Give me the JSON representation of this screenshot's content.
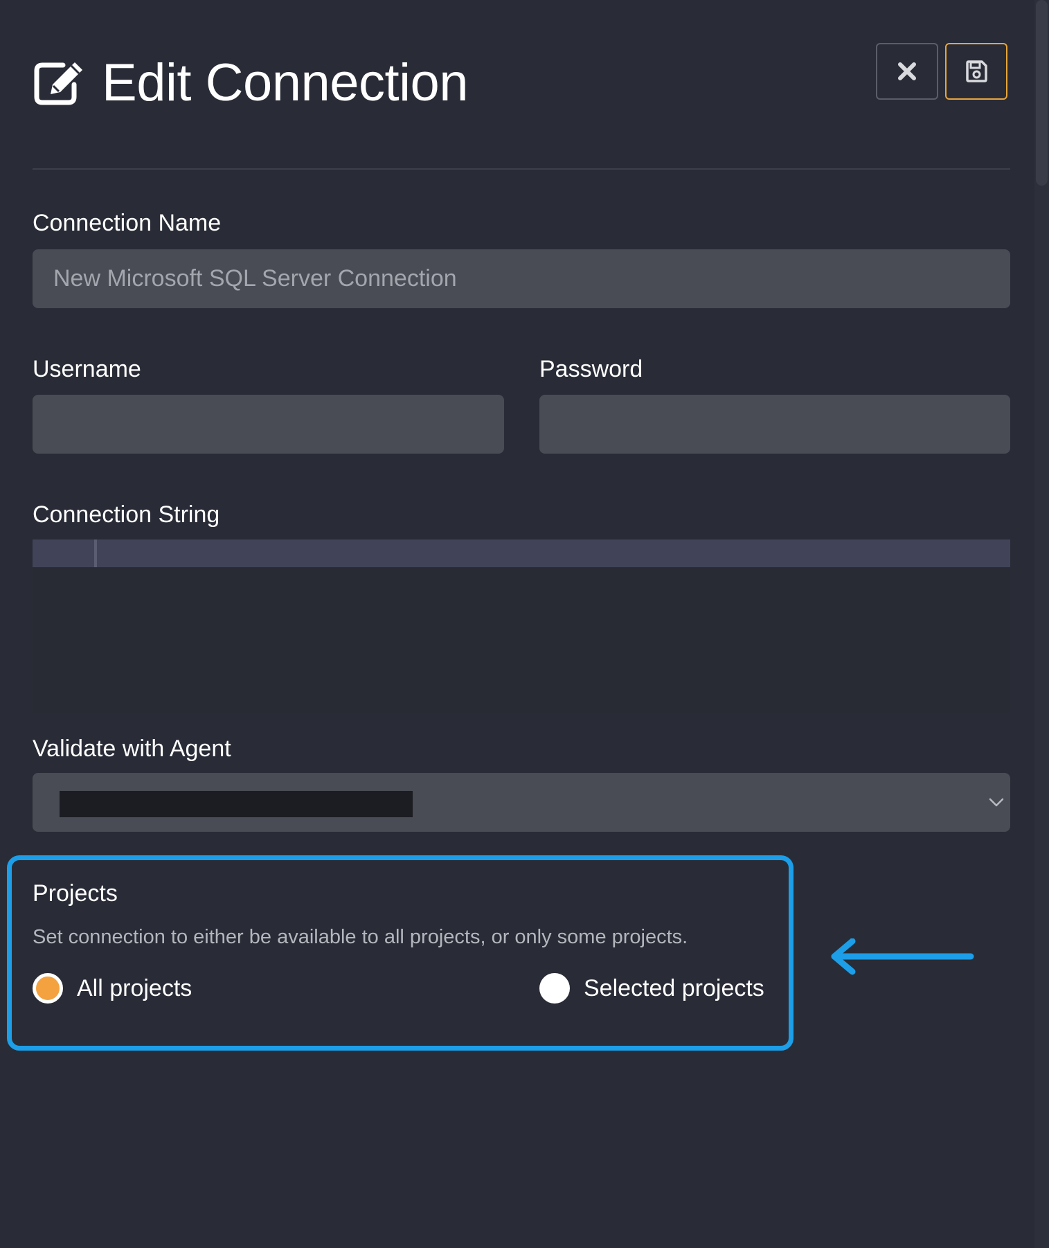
{
  "header": {
    "title": "Edit Connection",
    "title_icon": "edit-icon",
    "close_icon": "close-icon",
    "save_icon": "save-icon"
  },
  "form": {
    "connection_name": {
      "label": "Connection Name",
      "placeholder": "New Microsoft SQL Server Connection",
      "value": ""
    },
    "username": {
      "label": "Username",
      "value": ""
    },
    "password": {
      "label": "Password",
      "value": ""
    },
    "connection_string": {
      "label": "Connection String",
      "value": ""
    },
    "validate_with_agent": {
      "label": "Validate with Agent",
      "selected": "[redacted]",
      "chevron_icon": "chevron-down-icon"
    }
  },
  "projects": {
    "title": "Projects",
    "description": "Set connection to either be available to all projects, or only some projects.",
    "options": [
      {
        "label": "All projects",
        "checked": true
      },
      {
        "label": "Selected projects",
        "checked": false
      }
    ]
  },
  "annotation": {
    "highlight_color": "#1d9ee8",
    "arrow_icon": "arrow-left-icon"
  },
  "colors": {
    "background": "#292c36",
    "input_background": "#494b55",
    "accent": "#f3a23f",
    "save_border": "#e9a53c"
  }
}
